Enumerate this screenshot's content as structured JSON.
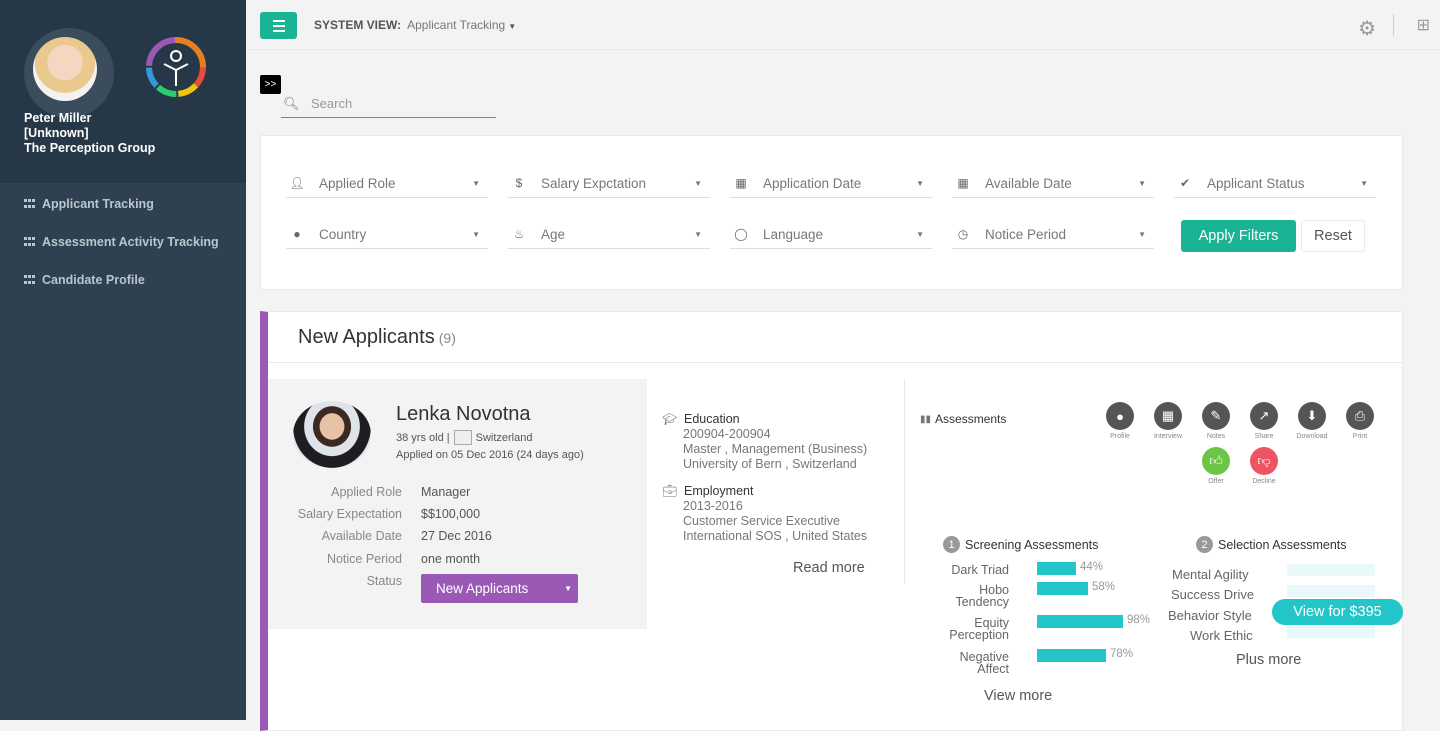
{
  "user": {
    "name": "Peter Miller",
    "role": "[Unknown]",
    "org": "The Perception Group"
  },
  "nav": [
    {
      "label": "Applicant Tracking",
      "icon": "grid-icon"
    },
    {
      "label": "Assessment Activity Tracking",
      "icon": "grid-icon"
    },
    {
      "label": "Candidate Profile",
      "icon": "grid-icon"
    }
  ],
  "topbar": {
    "label": "SYSTEM VIEW:",
    "value": "Applicant Tracking"
  },
  "expand_label": ">>",
  "search": {
    "placeholder": "Search"
  },
  "filters": {
    "row1": [
      "Applied Role",
      "Salary Expctation",
      "Application Date",
      "Available Date",
      "Applicant Status"
    ],
    "row2": [
      "Country",
      "Age",
      "Language",
      "Notice Period"
    ],
    "apply_label": "Apply Filters",
    "reset_label": "Reset"
  },
  "panel": {
    "title": "New Applicants",
    "count": "(9)"
  },
  "candidate": {
    "name": "Lenka Novotna",
    "age": "38 yrs old |",
    "country": "Switzerland",
    "applied": "Applied on 05 Dec 2016 (24 days ago)",
    "fields": [
      {
        "label": "Applied Role",
        "value": "Manager"
      },
      {
        "label": "Salary Expectation",
        "value": "$$100,000"
      },
      {
        "label": "Available Date",
        "value": "27 Dec 2016"
      },
      {
        "label": "Notice Period",
        "value": "one month"
      }
    ],
    "status_label": "Status",
    "status": "New Applicants"
  },
  "education": {
    "title": "Education",
    "lines": [
      "200904-200904",
      "Master , Management (Business)",
      "University of Bern , Switzerland"
    ]
  },
  "employment": {
    "title": "Employment",
    "lines": [
      "2013-2016",
      "Customer Service Executive",
      "International SOS , United States"
    ]
  },
  "read_more": "Read more",
  "assessments_label": "Assessments",
  "actions": [
    {
      "label": "Profile",
      "icon": "user-icon"
    },
    {
      "label": "Interview",
      "icon": "calendar-icon"
    },
    {
      "label": "Notes",
      "icon": "pencil-icon"
    },
    {
      "label": "Share",
      "icon": "share-icon"
    },
    {
      "label": "Download",
      "icon": "download-icon"
    },
    {
      "label": "Print",
      "icon": "print-icon"
    },
    {
      "label": "Offer",
      "icon": "thumbs-up-icon"
    },
    {
      "label": "Decline",
      "icon": "thumbs-down-icon"
    }
  ],
  "screening": {
    "num": "1",
    "title": "Screening Assessments",
    "items": [
      {
        "name": "Dark Triad",
        "pct": 44
      },
      {
        "name": "Hobo Tendency",
        "pct": 58
      },
      {
        "name": "Equity Perception",
        "pct": 98
      },
      {
        "name": "Negative Affect",
        "pct": 78
      }
    ]
  },
  "selection": {
    "num": "2",
    "title": "Selection Assessments",
    "items": [
      "Mental Agility",
      "Success Drive",
      "Behavior Style",
      "Work Ethic"
    ],
    "cta": "View for $395",
    "more": "Plus more"
  },
  "view_more": "View more",
  "colors": {
    "accent": "#1ab394",
    "status": "#9b59b6",
    "bar": "#23c6c8",
    "offer": "#6cc644",
    "decline": "#ed5565"
  }
}
